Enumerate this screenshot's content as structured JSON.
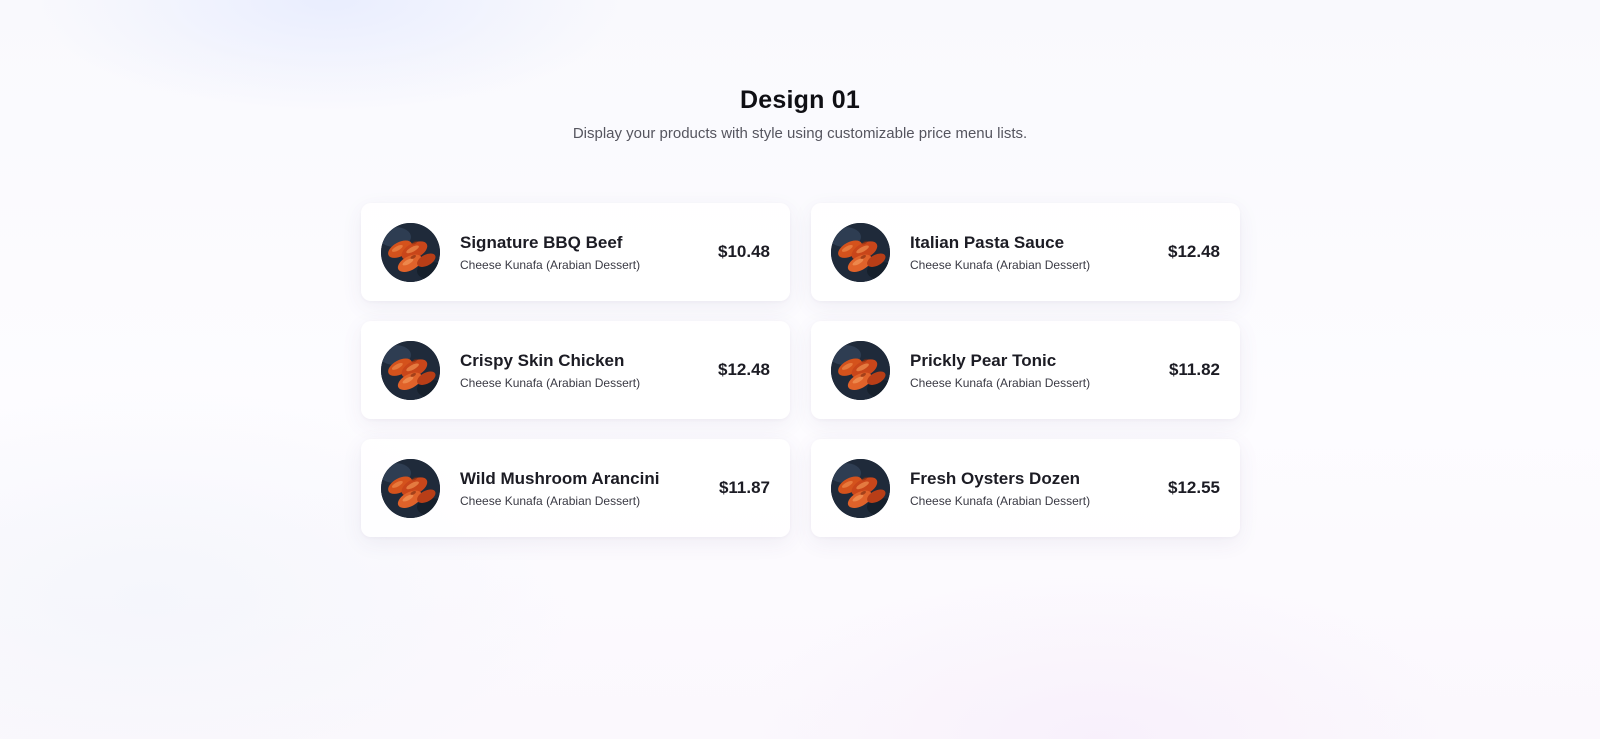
{
  "header": {
    "title": "Design 01",
    "subtitle": "Display your products with style using customizable price menu lists."
  },
  "menu": {
    "items": [
      {
        "name": "Signature BBQ Beef",
        "description": "Cheese Kunafa (Arabian Dessert)",
        "price": "$10.48",
        "icon": "food-thumbnail"
      },
      {
        "name": "Italian Pasta Sauce",
        "description": "Cheese Kunafa (Arabian Dessert)",
        "price": "$12.48",
        "icon": "food-thumbnail"
      },
      {
        "name": "Crispy Skin Chicken",
        "description": "Cheese Kunafa (Arabian Dessert)",
        "price": "$12.48",
        "icon": "food-thumbnail"
      },
      {
        "name": "Prickly Pear Tonic",
        "description": "Cheese Kunafa (Arabian Dessert)",
        "price": "$11.82",
        "icon": "food-thumbnail"
      },
      {
        "name": "Wild Mushroom Arancini",
        "description": "Cheese Kunafa (Arabian Dessert)",
        "price": "$11.87",
        "icon": "food-thumbnail"
      },
      {
        "name": "Fresh Oysters Dozen",
        "description": "Cheese Kunafa (Arabian Dessert)",
        "price": "$12.55",
        "icon": "food-thumbnail"
      }
    ]
  },
  "colors": {
    "text_primary": "#1c1c24",
    "text_secondary": "#55555f",
    "card_background": "#ffffff",
    "thumbnail_dark": "#1f2a3a",
    "thumbnail_food": "#d4521c"
  }
}
